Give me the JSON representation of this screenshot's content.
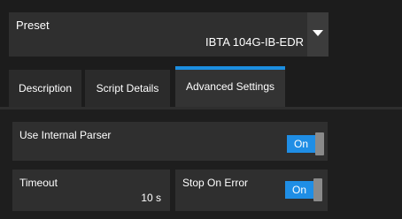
{
  "preset": {
    "label": "Preset",
    "value": "IBTA 104G-IB-EDR",
    "dropdown_icon": "caret-down-icon"
  },
  "tabs": [
    {
      "label": "Description",
      "active": false
    },
    {
      "label": "Script Details",
      "active": false
    },
    {
      "label": "Advanced Settings",
      "active": true
    }
  ],
  "settings": {
    "use_internal_parser": {
      "label": "Use Internal Parser",
      "toggle": "On"
    },
    "timeout": {
      "label": "Timeout",
      "value": "10 s"
    },
    "stop_on_error": {
      "label": "Stop On Error",
      "toggle": "On"
    }
  },
  "colors": {
    "accent": "#1c8ee0",
    "background": "#181818",
    "panel": "#2f2f2f"
  }
}
